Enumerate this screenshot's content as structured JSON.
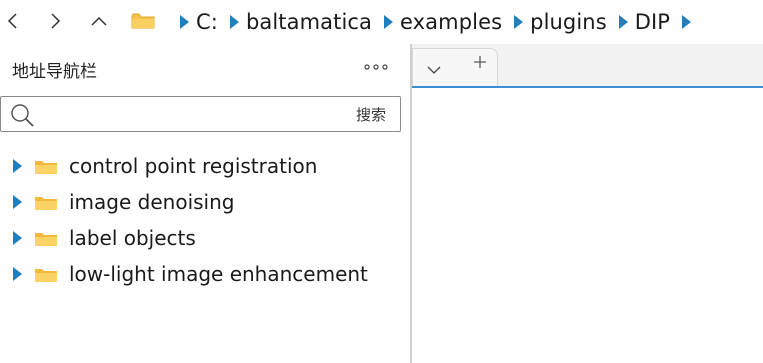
{
  "address_bar": {
    "segments": [
      "C:",
      "baltamatica",
      "examples",
      "plugins",
      "DIP"
    ]
  },
  "nav_panel": {
    "title": "地址导航栏",
    "more_label": "•••",
    "search": {
      "placeholder": "",
      "button_label": "搜索"
    },
    "tree_items": [
      {
        "label": "control point registration"
      },
      {
        "label": "image denoising"
      },
      {
        "label": "label objects"
      },
      {
        "label": "low-light image enhancement"
      }
    ]
  },
  "editor": {
    "tab_dropdown_icon": "chevron-down-icon",
    "tab_add_icon": "plus-icon"
  },
  "colors": {
    "accent": "#1f7fbf",
    "folder": "#f6c24b",
    "tab_underline": "#3a8fd0"
  }
}
